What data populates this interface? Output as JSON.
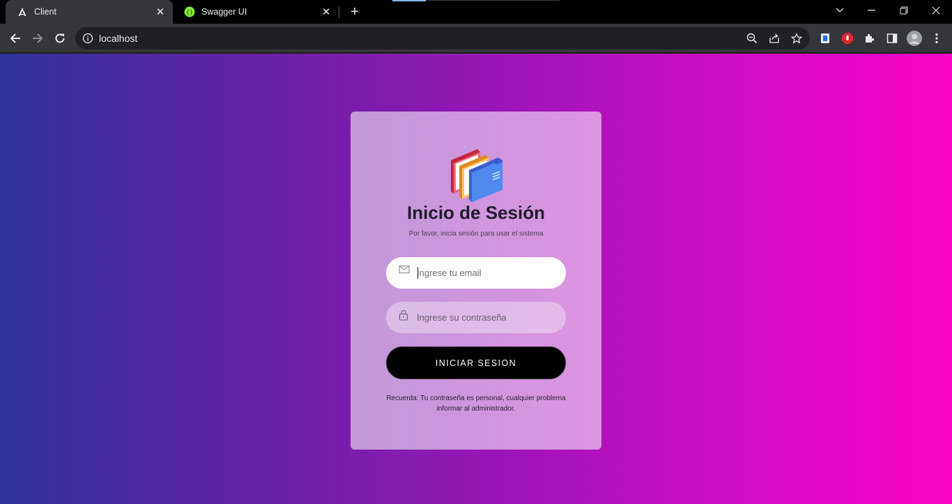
{
  "browser": {
    "tabs": [
      {
        "title": "Client",
        "active": true,
        "favicon": "angular-icon"
      },
      {
        "title": "Swagger UI",
        "active": false,
        "favicon": "swagger-icon"
      }
    ],
    "new_tab": "+",
    "url": "localhost"
  },
  "login": {
    "title": "Inicio de Sesión",
    "subtitle": "Por favor, inicia sesión para usar el sistema",
    "email_placeholder": "Ingrese tu email",
    "password_placeholder": "Ingrese su contraseña",
    "submit_label": "INICIAR SESION",
    "note": "Recuerda: Tu contraseña es personal, cualquier problema informar al administrador."
  },
  "colors": {
    "gradient_start": "#30339a",
    "gradient_end": "#fd04c9",
    "button": "#000000"
  }
}
